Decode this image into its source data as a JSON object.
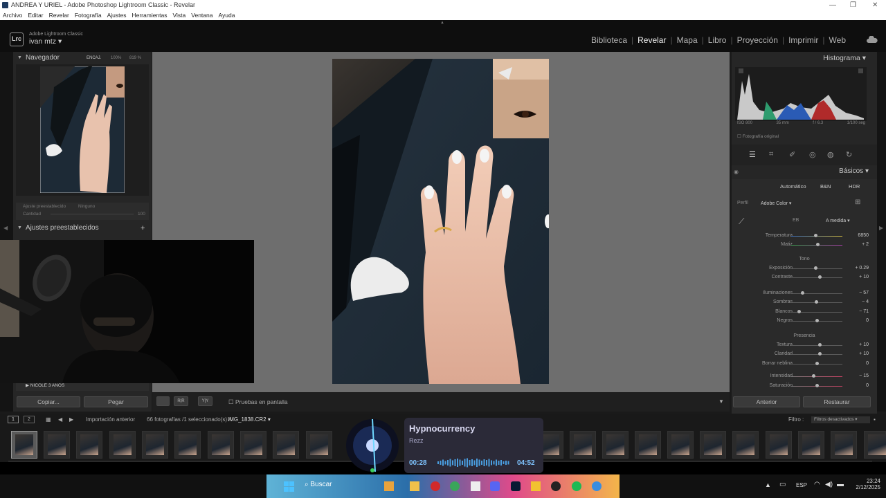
{
  "window": {
    "title": "ANDREA Y URIEL - Adobe Photoshop Lightroom Classic - Revelar"
  },
  "menu": [
    "Archivo",
    "Editar",
    "Revelar",
    "Fotografía",
    "Ajustes",
    "Herramientas",
    "Vista",
    "Ventana",
    "Ayuda"
  ],
  "brand": {
    "app": "Adobe Lightroom Classic",
    "user": "ivan mtz",
    "badge": "Lrc"
  },
  "modules": [
    "Biblioteca",
    "Revelar",
    "Mapa",
    "Libro",
    "Proyección",
    "Imprimir",
    "Web"
  ],
  "active_module": "Revelar",
  "left": {
    "navigator": {
      "title": "Navegador",
      "fit": "ENCAJ.",
      "z1": "100%",
      "z2": "819 %"
    },
    "preset_info": {
      "label": "Ajuste preestablecido",
      "value": "Ninguno",
      "amount_label": "Cantidad",
      "amount_value": "100"
    },
    "presets_title": "Ajustes preestablecidos",
    "preset_folder": "NICOLE 3 AÑOS",
    "copy": "Copiar...",
    "paste": "Pegar"
  },
  "toolbar": {
    "soft_proof": "Pruebas en pantalla",
    "yy": "Y|Y",
    "ab": "R|R"
  },
  "right": {
    "histogram_title": "Histograma",
    "exif": [
      "ISO 800",
      "35 mm",
      "f / 6.3",
      "1/100 seg"
    ],
    "original_photo": "Fotografía original",
    "basic_title": "Básicos",
    "treatment": [
      "Automático",
      "B&N",
      "HDR"
    ],
    "profile_label": "Perfil",
    "profile_value": "Adobe Color",
    "wb_label": "EB",
    "wb_value": "A medida",
    "sections": {
      "tone": "Tono",
      "presence": "Presencia"
    },
    "sliders": [
      {
        "label": "Temperatura",
        "value": "6850",
        "pos": 0.47
      },
      {
        "label": "Matiz",
        "value": "+ 2",
        "pos": 0.51
      },
      {
        "label": "Exposición",
        "value": "+ 0.29",
        "pos": 0.47
      },
      {
        "label": "Contraste",
        "value": "+ 10",
        "pos": 0.55
      },
      {
        "label": "Iluminaciones",
        "value": "− 57",
        "pos": 0.22
      },
      {
        "label": "Sombras",
        "value": "− 4",
        "pos": 0.48
      },
      {
        "label": "Blancos",
        "value": "− 71",
        "pos": 0.15
      },
      {
        "label": "Negros",
        "value": "0",
        "pos": 0.5
      },
      {
        "label": "Textura",
        "value": "+ 10",
        "pos": 0.55
      },
      {
        "label": "Claridad",
        "value": "+ 10",
        "pos": 0.55
      },
      {
        "label": "Borrar neblina",
        "value": "0",
        "pos": 0.5
      },
      {
        "label": "Intensidad",
        "value": "− 15",
        "pos": 0.43
      },
      {
        "label": "Saturación",
        "value": "0",
        "pos": 0.5
      }
    ],
    "prev": "Anterior",
    "reset": "Restaurar"
  },
  "filmbar": {
    "source": "Importación anterior",
    "count": "66 fotografías /1 seleccionado(s) /",
    "file": "IMG_1838.CR2",
    "filter_label": "Filtro :",
    "filter_value": "Filtros desactivados",
    "page1": "1",
    "page2": "2"
  },
  "music": {
    "title": "Hypnocurrency",
    "artist": "Rezz",
    "elapsed": "00:28",
    "total": "04:52"
  },
  "taskbar": {
    "search": "Buscar",
    "lang": "ESP",
    "time": "23:24",
    "date": "2/12/2025"
  },
  "colors": {
    "accent": "#0078d4",
    "panel": "#262626",
    "canvas": "#6e6e6e"
  }
}
